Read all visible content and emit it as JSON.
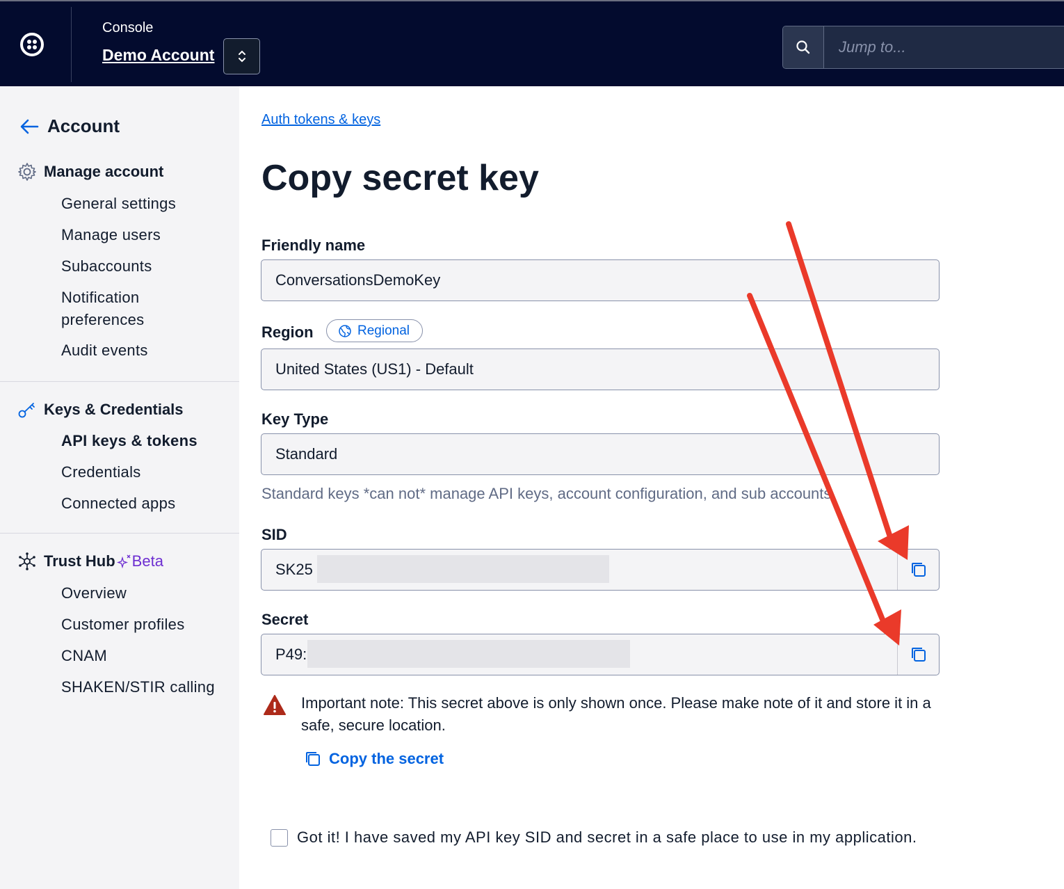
{
  "header": {
    "console_label": "Console",
    "account_name": "Demo Account",
    "search_placeholder": "Jump to..."
  },
  "sidebar": {
    "back_title": "Account",
    "sections": [
      {
        "label": "Manage account",
        "icon": "gear-icon",
        "items": [
          "General settings",
          "Manage users",
          "Subaccounts",
          "Notification preferences",
          "Audit events"
        ]
      },
      {
        "label": "Keys & Credentials",
        "icon": "key-icon",
        "items": [
          "API keys & tokens",
          "Credentials",
          "Connected apps"
        ],
        "active_item": "API keys & tokens"
      },
      {
        "label": "Trust Hub",
        "badge": "Beta",
        "icon": "trust-hub-icon",
        "items": [
          "Overview",
          "Customer profiles",
          "CNAM",
          "SHAKEN/STIR calling"
        ]
      }
    ]
  },
  "main": {
    "breadcrumb": "Auth tokens & keys",
    "title": "Copy secret key",
    "friendly_name": {
      "label": "Friendly name",
      "value": "ConversationsDemoKey"
    },
    "region": {
      "label": "Region",
      "badge": "Regional",
      "value": "United States (US1) - Default"
    },
    "key_type": {
      "label": "Key Type",
      "value": "Standard",
      "help": "Standard keys *can not* manage API keys, account configuration, and sub accounts."
    },
    "sid": {
      "label": "SID",
      "value": "SK25"
    },
    "secret": {
      "label": "Secret",
      "value": "P49:"
    },
    "note": "Important note: This secret above is only shown once. Please make note of it and store it in a safe, secure location.",
    "copy_link": "Copy the secret",
    "acknowledge": "Got it! I have saved my API key SID and secret in a safe place to use in my application."
  },
  "colors": {
    "topbar": "#030b2e",
    "link": "#0263e0",
    "annotation_arrow": "#ea3a2a",
    "warning": "#ad2a1a",
    "beta": "#6d2ed1"
  }
}
